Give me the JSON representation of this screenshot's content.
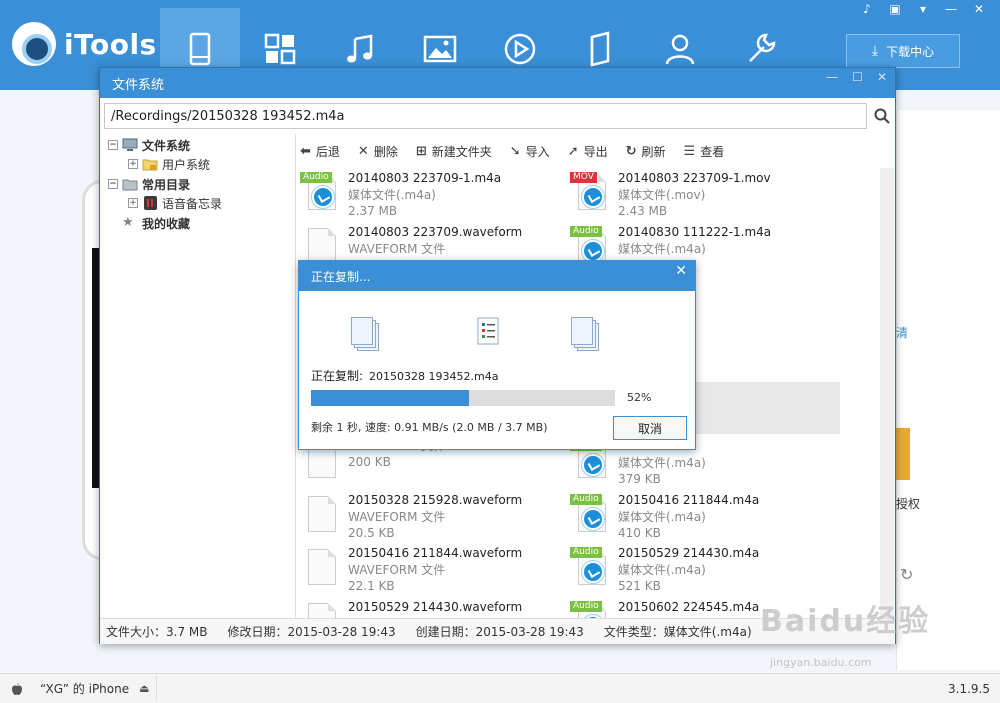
{
  "app": {
    "logo_text": "iTools",
    "download_center": "下载中心",
    "version": "3.1.9.5",
    "device_label": "“XG” 的 iPhone"
  },
  "nav": [
    {
      "icon": "phone-icon"
    },
    {
      "icon": "apps-icon"
    },
    {
      "icon": "music-icon"
    },
    {
      "icon": "photo-icon"
    },
    {
      "icon": "video-icon"
    },
    {
      "icon": "book-icon"
    },
    {
      "icon": "contacts-icon"
    },
    {
      "icon": "tools-icon"
    }
  ],
  "background": {
    "link_fragment": "清",
    "auth_fragment": "授权"
  },
  "file_system": {
    "title": "文件系统",
    "path": "/Recordings/20150328 193452.m4a",
    "tree": {
      "root": "文件系统",
      "user_system": "用户系统",
      "common": "常用目录",
      "voice_memo": "语音备忘录",
      "favorites": "我的收藏"
    },
    "toolbar": {
      "back": "后退",
      "delete": "删除",
      "new_folder": "新建文件夹",
      "import": "导入",
      "export": "导出",
      "refresh": "刷新",
      "view": "查看"
    },
    "files_left": [
      {
        "name": "20140803 223709-1.m4a",
        "type": "媒体文件(.m4a)",
        "size": "2.37 MB",
        "badge": "Audio"
      },
      {
        "name": "20140803 223709.waveform",
        "type": "WAVEFORM 文件",
        "size": "",
        "badge": ""
      },
      {
        "name": "",
        "type": "",
        "size": "",
        "badge": ""
      },
      {
        "name": "",
        "type": "",
        "size": "",
        "badge": ""
      },
      {
        "name": "",
        "type": "",
        "size": "",
        "badge": ""
      },
      {
        "name": "",
        "type": "WAVEFORM 文件",
        "size": "200 KB",
        "badge": ""
      },
      {
        "name": "20150328 215928.waveform",
        "type": "WAVEFORM 文件",
        "size": "20.5 KB",
        "badge": ""
      },
      {
        "name": "20150416 211844.waveform",
        "type": "WAVEFORM 文件",
        "size": "22.1 KB",
        "badge": ""
      },
      {
        "name": "20150529 214430.waveform",
        "type": "",
        "size": "",
        "badge": ""
      }
    ],
    "files_right": [
      {
        "name": "20140803 223709-1.mov",
        "type": "媒体文件(.mov)",
        "size": "2.43 MB",
        "badge": "MOV"
      },
      {
        "name": "20140830 111222-1.m4a",
        "type": "媒体文件(.m4a)",
        "size": "",
        "badge": "Audio"
      },
      {
        "name": "0607-1.m4a",
        "type": "",
        "size": "",
        "badge": "Audio"
      },
      {
        "name": "5833-1.m4a",
        "type": "",
        "size": "",
        "badge": "Audio"
      },
      {
        "name": "3452.m4a",
        "type": "a)",
        "size": "",
        "badge": "Audio"
      },
      {
        "name": "5928.m4a",
        "type": "媒体文件(.m4a)",
        "size": "379 KB",
        "badge": "Audio"
      },
      {
        "name": "20150416 211844.m4a",
        "type": "媒体文件(.m4a)",
        "size": "410 KB",
        "badge": "Audio"
      },
      {
        "name": "20150529 214430.m4a",
        "type": "媒体文件(.m4a)",
        "size": "521 KB",
        "badge": "Audio"
      },
      {
        "name": "20150602 224545.m4a",
        "type": "",
        "size": "",
        "badge": "Audio"
      }
    ],
    "status": {
      "size": "文件大小：3.7 MB",
      "modified": "修改日期：2015-03-28 19:43",
      "created": "创建日期：2015-03-28 19:43",
      "filetype": "文件类型：媒体文件(.m4a)"
    }
  },
  "copy_dialog": {
    "title": "正在复制...",
    "label": "正在复制:",
    "filename": "20150328 193452.m4a",
    "progress_percent": 52,
    "progress_text": "52%",
    "remaining": "剩余 1 秒, 速度: 0.91 MB/s   (2.0 MB / 3.7 MB)",
    "cancel": "取消"
  },
  "watermark": {
    "brand": "Baidu经验",
    "url": "jingyan.baidu.com"
  }
}
